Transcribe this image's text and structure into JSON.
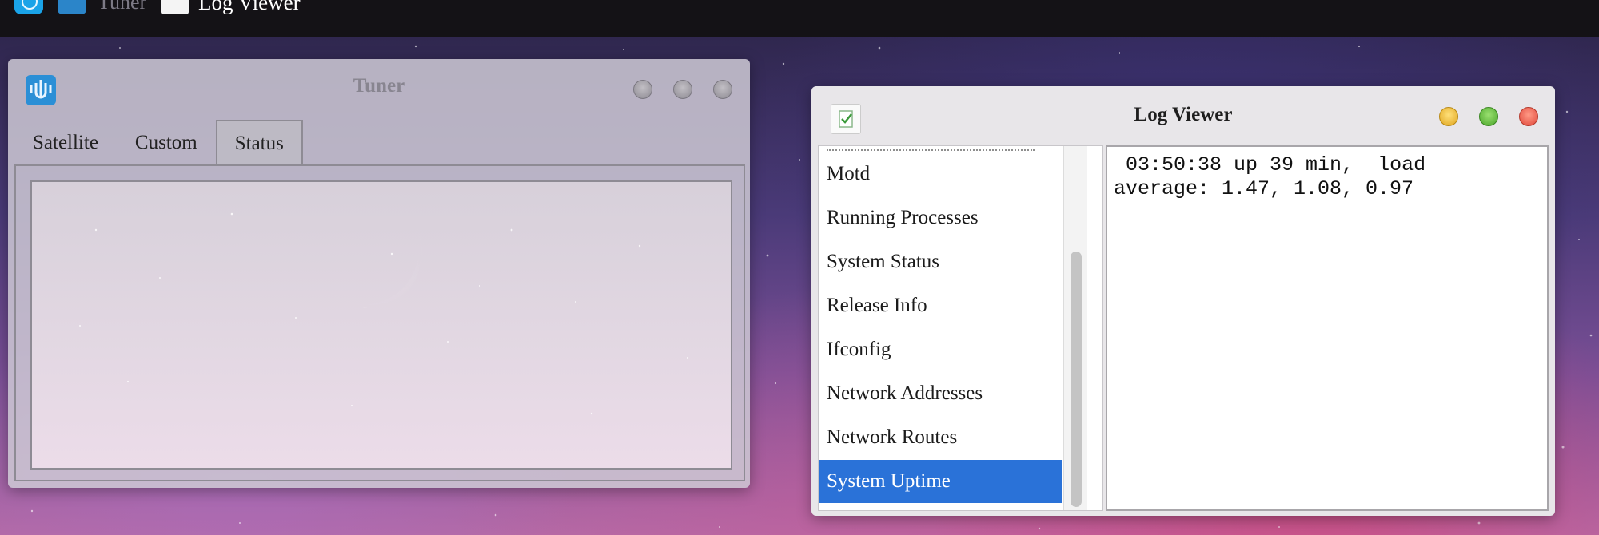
{
  "taskbar": {
    "items": [
      {
        "label": "",
        "icon": "launcher-icon"
      },
      {
        "label": "Tuner",
        "icon": "tuner-icon"
      },
      {
        "label": "Log Viewer",
        "icon": "log-viewer-icon"
      }
    ]
  },
  "tuner_window": {
    "title": "Tuner",
    "tabs": [
      {
        "label": "Satellite",
        "active": false
      },
      {
        "label": "Custom",
        "active": false
      },
      {
        "label": "Status",
        "active": true
      }
    ],
    "controls": [
      "minimize",
      "maximize",
      "close"
    ]
  },
  "log_viewer_window": {
    "title": "Log Viewer",
    "controls": [
      "minimize",
      "maximize",
      "close"
    ],
    "log_list": [
      {
        "label": "Motd",
        "selected": false
      },
      {
        "label": "Running Processes",
        "selected": false
      },
      {
        "label": "System Status",
        "selected": false
      },
      {
        "label": "Release Info",
        "selected": false
      },
      {
        "label": "Ifconfig",
        "selected": false
      },
      {
        "label": "Network Addresses",
        "selected": false
      },
      {
        "label": "Network Routes",
        "selected": false
      },
      {
        "label": "System Uptime",
        "selected": true
      }
    ],
    "log_output": " 03:50:38 up 39 min,  load\naverage: 1.47, 1.08, 0.97"
  },
  "colors": {
    "selection": "#2a72d8",
    "tuner_icon": "#2b8fd6",
    "taskbar": "#141216"
  }
}
